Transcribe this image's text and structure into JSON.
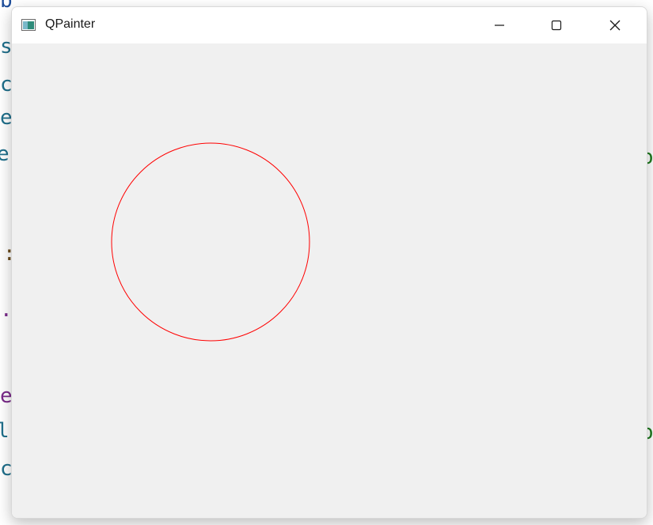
{
  "window": {
    "title": "QPainter",
    "app_icon": "qt-window-icon",
    "controls": {
      "minimize_icon": "minimize-icon",
      "maximize_icon": "maximize-icon",
      "close_icon": "close-icon"
    }
  },
  "client": {
    "background_color": "#f0f0f0"
  },
  "drawing": {
    "shape": "circle",
    "stroke_color": "#ff0000",
    "fill": "none"
  }
}
